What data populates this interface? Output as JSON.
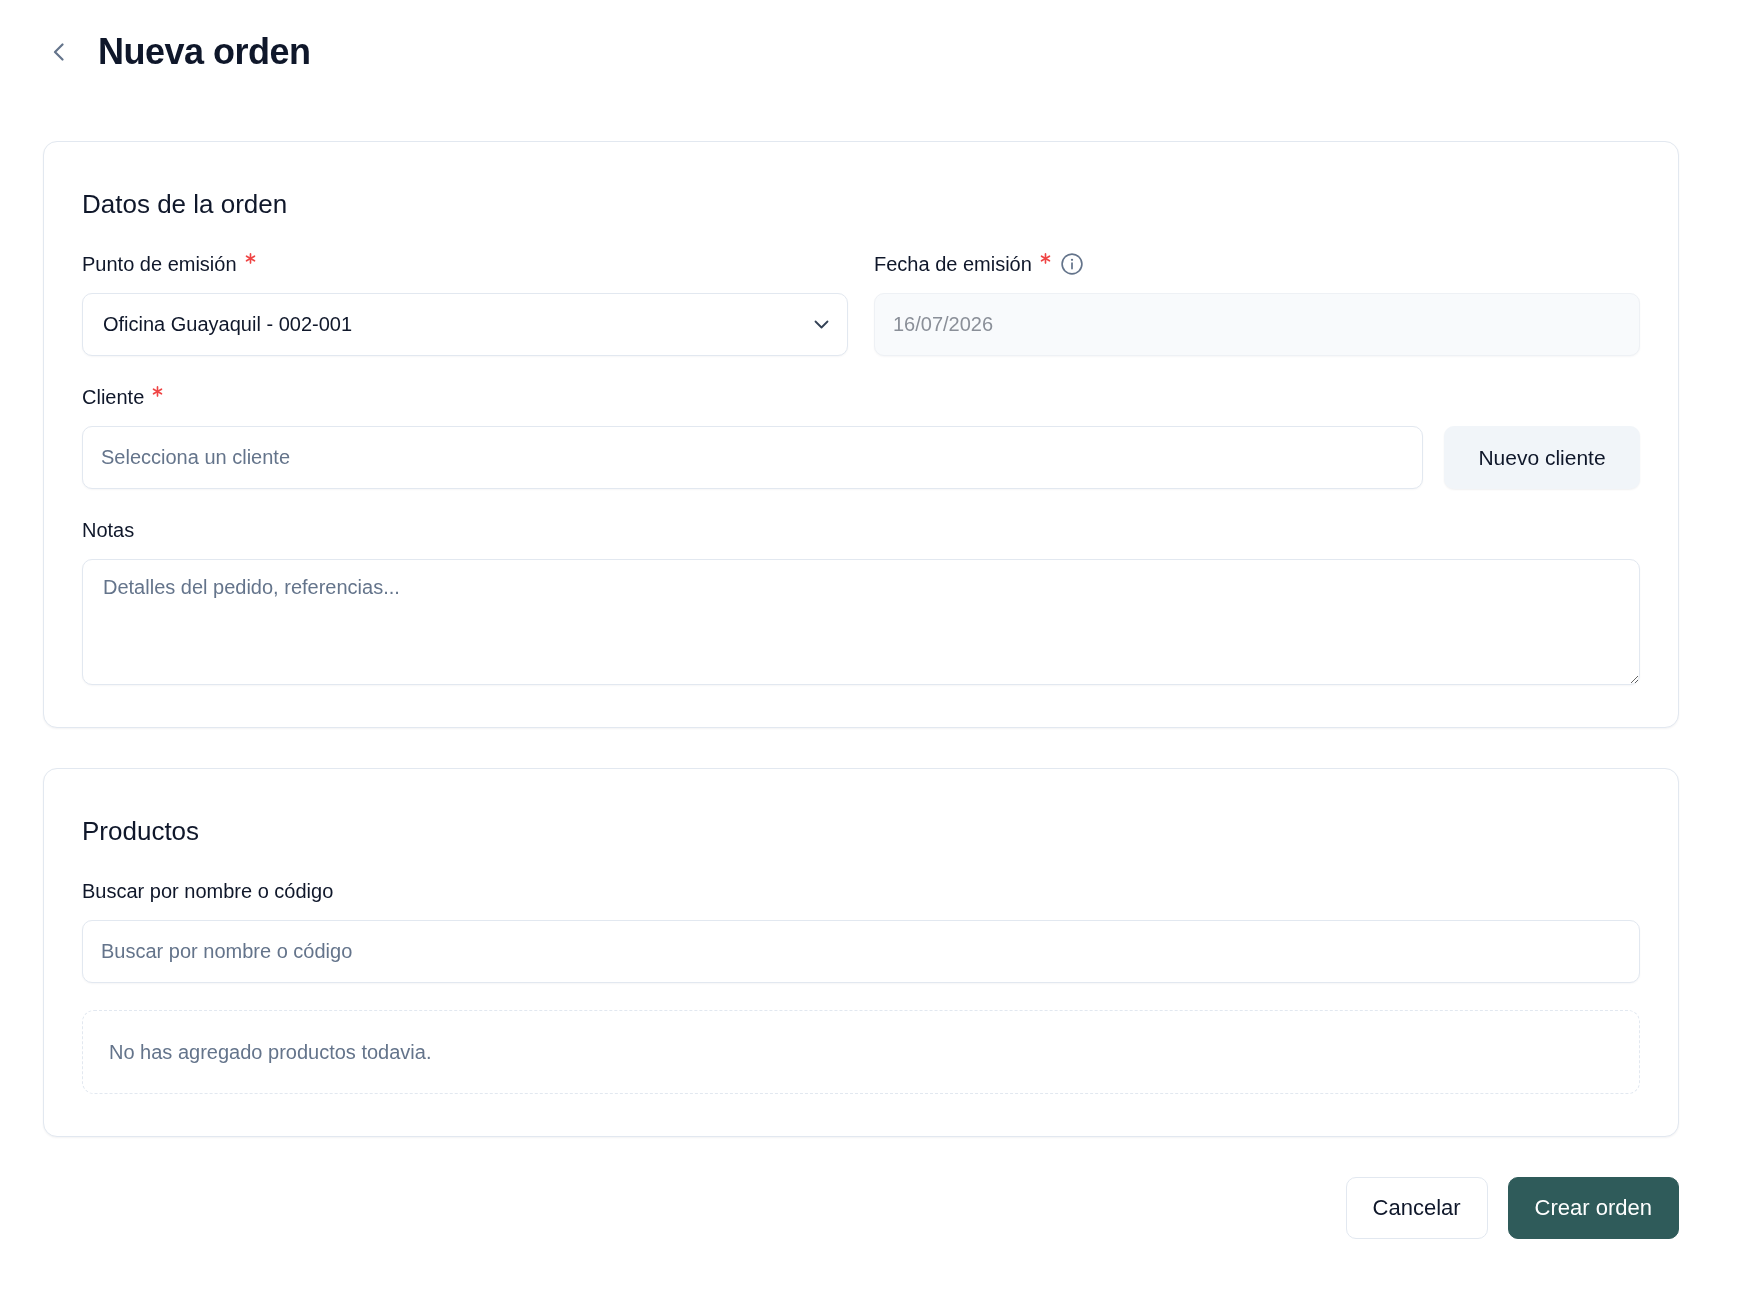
{
  "header": {
    "title": "Nueva orden"
  },
  "order_details": {
    "title": "Datos de la orden",
    "emission_point": {
      "label": "Punto de emisión",
      "required": true,
      "value": "Oficina Guayaquil - 002-001"
    },
    "emission_date": {
      "label": "Fecha de emisión",
      "required": true,
      "info": true,
      "value": "16/07/2026",
      "disabled": true
    },
    "client": {
      "label": "Cliente",
      "required": true,
      "placeholder": "Selecciona un cliente",
      "button": "Nuevo cliente"
    },
    "notes": {
      "label": "Notas",
      "placeholder": "Detalles del pedido, referencias..."
    }
  },
  "products": {
    "title": "Productos",
    "search": {
      "label": "Buscar por nombre o código",
      "placeholder": "Buscar por nombre o código"
    },
    "empty_message": "No has agregado productos todavia."
  },
  "actions": [
    {
      "label": "Cancelar",
      "kind": "secondary"
    },
    {
      "label": "Crear orden",
      "kind": "primary"
    }
  ]
}
